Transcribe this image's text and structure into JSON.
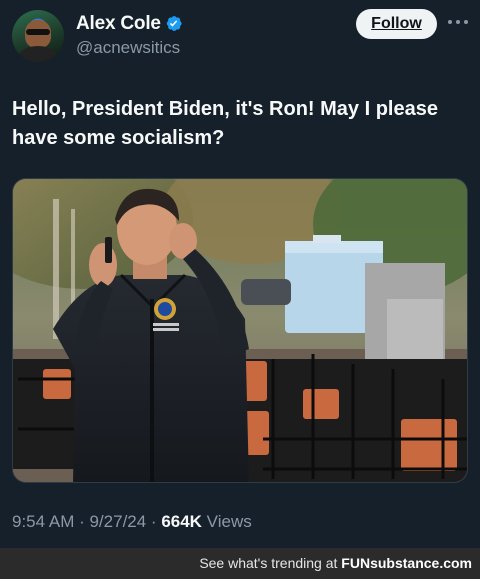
{
  "author": {
    "display_name": "Alex Cole",
    "handle": "@acnewsitics",
    "verified": true
  },
  "actions": {
    "follow_label": "Follow"
  },
  "tweet": {
    "text": "Hello, President Biden, it's Ron!  May I please have some socialism?"
  },
  "meta": {
    "time_date": "9:54 AM · 9/27/24 · ",
    "views_count": "664K",
    "views_label": " Views"
  },
  "watermark": {
    "prefix": "See what's trending at ",
    "brand": "FUNsubstance.com"
  },
  "colors": {
    "background": "#15202b",
    "verified": "#1d9bf0",
    "secondary_text": "#8b98a5",
    "footer_bar": "#2b2b2b"
  }
}
